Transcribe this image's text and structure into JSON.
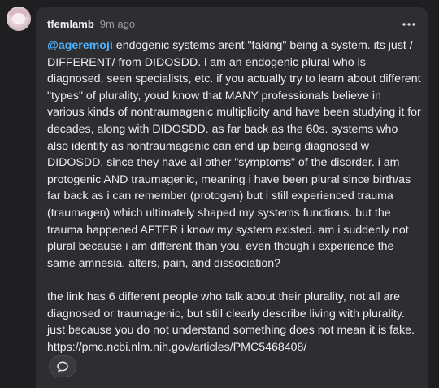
{
  "post": {
    "username": "tfemlamb",
    "time": "9m ago",
    "more_icon": "more-horizontal-icon",
    "mention": "@ageremoji",
    "body_1": " endogenic systems arent \"faking\" being a system. its just / DIFFERENT/ from DIDOSDD. i am an endogenic plural who is diagnosed, seen specialists, etc. if you actually try to learn about different \"types\" of plurality, youd know that MANY professionals believe in various kinds of nontraumagenic multiplicity and have been studying it for decades, along with DIDOSDD. as far back as the 60s. systems who also identify as nontraumagenic can end up being diagnosed w DIDOSDD, since they have all other \"symptoms\" of the disorder. i am protogenic AND traumagenic, meaning i have been plural since birth/as far back as i can remember (protogen) but i still experienced trauma (traumagen) which ultimately shaped my systems functions. but the trauma happened AFTER i know my system existed. am i suddenly not plural because i am different than you, even though i experience the same amnesia, alters, pain, and dissociation?",
    "body_2": "the link has 6 different people who talk about their plurality, not all are diagnosed or traumagenic, but still clearly describe living with plurality. just because you do not understand something does not mean it is fake. https://pmc.ncbi.nlm.nih.gov/articles/PMC5468408/",
    "reply_icon": "speech-bubble-icon"
  },
  "colors": {
    "page_bg": "#1f1f21",
    "card_bg": "#2e2e31",
    "mention": "#4fb3ff",
    "text": "#ececef",
    "muted": "#9a9aa0"
  }
}
